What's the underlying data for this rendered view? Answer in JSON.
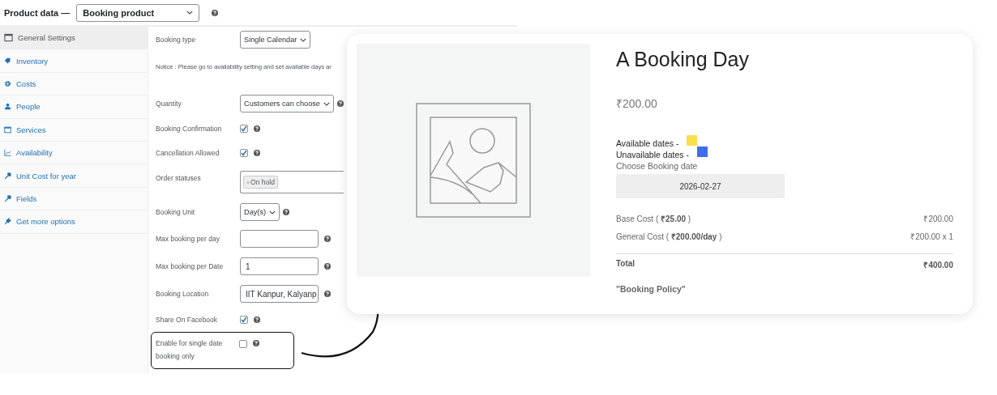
{
  "header": {
    "title": "Product data —",
    "product_type": "Booking product"
  },
  "sidebar": {
    "items": [
      {
        "label": "General Settings",
        "selected": true
      },
      {
        "label": "Inventory",
        "selected": false
      },
      {
        "label": "Costs",
        "selected": false
      },
      {
        "label": "People",
        "selected": false
      },
      {
        "label": "Services",
        "selected": false
      },
      {
        "label": "Availability",
        "selected": false
      },
      {
        "label": "Unit Cost for year",
        "selected": false
      },
      {
        "label": "Fields",
        "selected": false
      },
      {
        "label": "Get more options",
        "selected": false
      }
    ]
  },
  "form": {
    "rows": [
      {
        "kind": "select",
        "label": "Booking type",
        "value": "Single Calendar",
        "help": false,
        "highlighted": false
      },
      {
        "kind": "notice",
        "label": "Notice : Please go to availability setting and set available days ar",
        "highlighted": false
      },
      {
        "kind": "select",
        "label": "Quantity",
        "value": "Customers can choose",
        "help": true,
        "highlighted": false
      },
      {
        "kind": "checkbox",
        "label": "Booking Confirmation",
        "checked": true,
        "help": true,
        "highlighted": false
      },
      {
        "kind": "checkbox",
        "label": "Cancellation Allowed",
        "checked": true,
        "help": true,
        "highlighted": false
      },
      {
        "kind": "tags",
        "label": "Order statuses",
        "tags": [
          {
            "remove": "×",
            "label": "On hold"
          }
        ],
        "highlighted": false
      },
      {
        "kind": "select",
        "label": "Booking Unit",
        "value": "Day(s)",
        "help": true,
        "highlighted": false
      },
      {
        "kind": "input",
        "label": "Max booking per day",
        "value": "",
        "help": true,
        "highlighted": false
      },
      {
        "kind": "input",
        "label": "Max booking per Date",
        "value": "1",
        "help": true,
        "highlighted": false
      },
      {
        "kind": "input",
        "label": "Booking Location",
        "value": "IIT Kanpur, Kalyanp",
        "help": true,
        "highlighted": false
      },
      {
        "kind": "checkbox",
        "label": "Share On Facebook",
        "checked": true,
        "help": true,
        "highlighted": false
      },
      {
        "kind": "checkbox",
        "label": "Enable for single date booking only",
        "checked": false,
        "help": true,
        "highlighted": true
      }
    ]
  },
  "preview": {
    "title": "A Booking Day",
    "price": "₹200.00",
    "legend": [
      {
        "label": "Available dates -",
        "color": "#f9e04b"
      },
      {
        "label": "Unavailable dates -",
        "color": "#3d6fe8"
      }
    ],
    "date_label": "Choose Booking date",
    "date_value": "2026-02-27",
    "costs": [
      {
        "label": "Base Cost ( **₹25.00** )",
        "amount": "₹200.00"
      },
      {
        "label": "General Cost ( **₹200.00/day** )",
        "amount": "₹200.00 x 1"
      }
    ],
    "total": {
      "label": "Total",
      "amount": "₹400.00"
    },
    "policy": "\"Booking Policy\""
  }
}
